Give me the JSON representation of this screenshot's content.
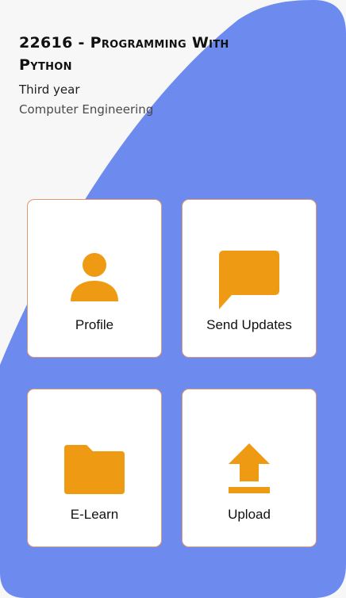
{
  "header": {
    "course_code": "22616 - ",
    "course_name_line1": "Programming With",
    "course_name_line2": "Python",
    "year": "Third year",
    "department": "Computer Engineering"
  },
  "cards": [
    {
      "label": "Profile",
      "icon": "person-icon"
    },
    {
      "label": "Send Updates",
      "icon": "chat-bubble-icon"
    },
    {
      "label": "E-Learn",
      "icon": "folder-icon"
    },
    {
      "label": "Upload",
      "icon": "upload-icon"
    }
  ],
  "colors": {
    "accent": "#ee9a12",
    "background_blue": "#6d8bef",
    "card_border": "#e09a72"
  }
}
